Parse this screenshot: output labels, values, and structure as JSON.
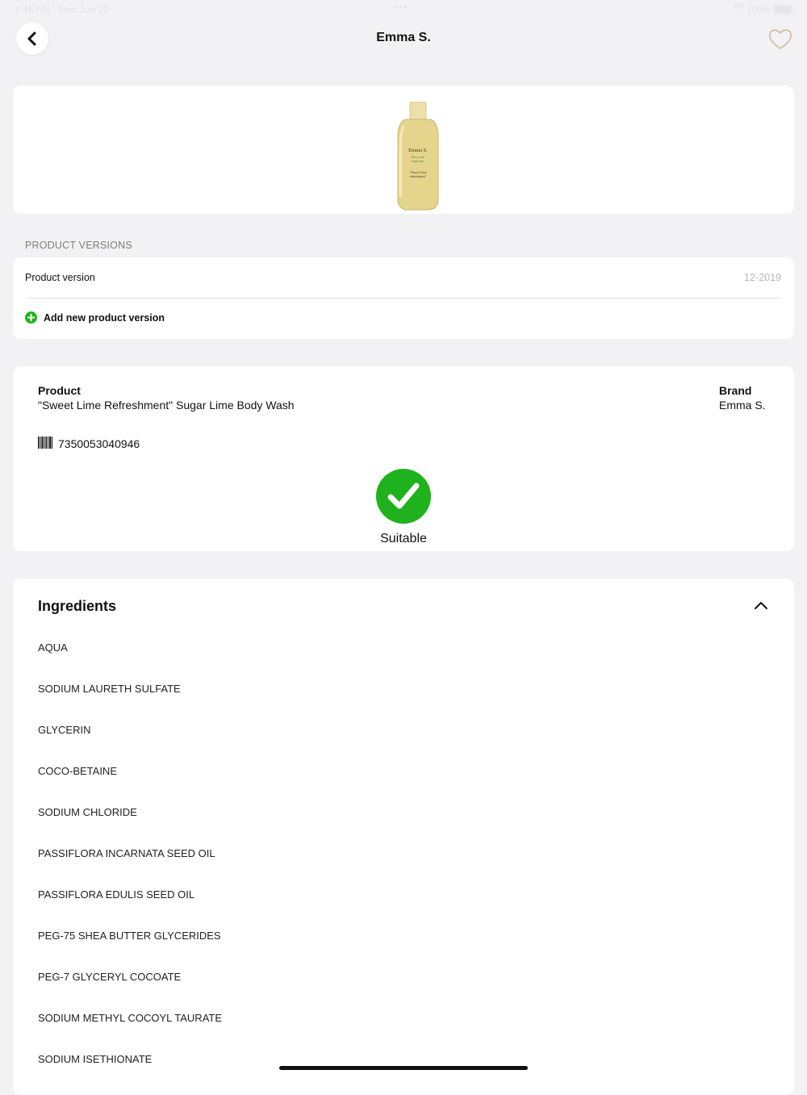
{
  "status_bar": {
    "time": "1:46 AM",
    "date": "Mon Jun 20",
    "battery": "100%"
  },
  "header": {
    "title": "Emma S."
  },
  "versions": {
    "section_title": "PRODUCT VERSIONS",
    "row_label": "Product version",
    "row_value": "12-2019",
    "add_label": "Add new product version"
  },
  "product": {
    "product_heading": "Product",
    "product_name": "\"Sweet Lime Refreshment\" Sugar Lime Body Wash",
    "brand_heading": "Brand",
    "brand_name": "Emma S.",
    "barcode": "7350053040946",
    "status": "Suitable",
    "image_brand": "Emma S.",
    "image_text_1": "Body wash",
    "image_text_2": "Sugar lime",
    "image_text_3": "\"Sweet Lime",
    "image_text_4": "refreshment\""
  },
  "ingredients": {
    "title": "Ingredients",
    "items": [
      "AQUA",
      "SODIUM LAURETH SULFATE",
      "GLYCERIN",
      "COCO-BETAINE",
      "SODIUM CHLORIDE",
      "PASSIFLORA INCARNATA SEED OIL",
      "PASSIFLORA EDULIS SEED OIL",
      "PEG-75 SHEA BUTTER GLYCERIDES",
      "PEG-7 GLYCERYL COCOATE",
      "SODIUM METHYL COCOYL TAURATE",
      "SODIUM ISETHIONATE"
    ]
  },
  "colors": {
    "accent_green": "#1fb21c",
    "background": "#f2f2f4",
    "favorite_outline": "#c9b89a"
  }
}
